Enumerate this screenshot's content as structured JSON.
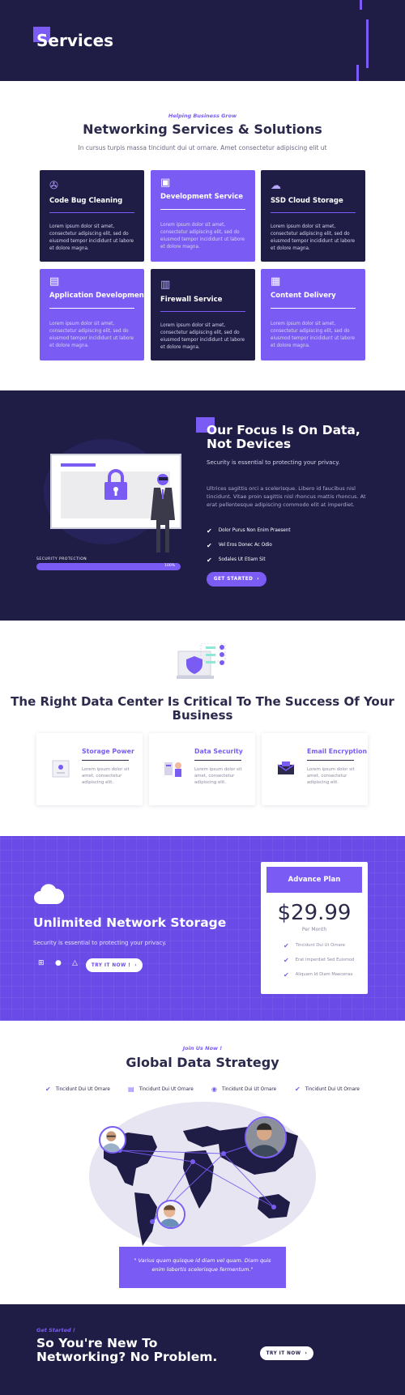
{
  "hero": {
    "title": "Services"
  },
  "services": {
    "eyebrow": "Helping Business Grow",
    "title": "Networking Services & Solutions",
    "subtitle": "In cursus turpis massa tincidunt dui ut ornare. Amet consectetur adipiscing elit ut",
    "cards": [
      {
        "title": "Code Bug Cleaning",
        "desc": "Lorem ipsum dolor sit amet, consectetur adipiscing elit, sed do eiusmod tempor incididunt ut labore et dolore magna.",
        "icon": "bug-icon"
      },
      {
        "title": "Development Service",
        "desc": "Lorem ipsum dolor sit amet, consectetur adipiscing elit, sed do eiusmod tempor incididunt ut labore et dolore magna.",
        "icon": "code-icon"
      },
      {
        "title": "SSD Cloud Storage",
        "desc": "Lorem ipsum dolor sit amet, consectetur adipiscing elit, sed do eiusmod tempor incididunt ut labore et dolore magna.",
        "icon": "cloud-icon"
      },
      {
        "title": "Application Development",
        "desc": "Lorem ipsum dolor sit amet, consectetur adipiscing elit, sed do eiusmod tempor incididunt ut labore et dolore magna.",
        "icon": "app-icon"
      },
      {
        "title": "Firewall Service",
        "desc": "Lorem ipsum dolor sit amet, consectetur adipiscing elit, sed do eiusmod tempor incididunt ut labore et dolore magna.",
        "icon": "firewall-icon"
      },
      {
        "title": "Content Delivery",
        "desc": "Lorem ipsum dolor sit amet, consectetur adipiscing elit, sed do eiusmod tempor incididunt ut labore et dolore magna.",
        "icon": "server-icon"
      }
    ]
  },
  "focus": {
    "title": "Our Focus Is On Data, Not Devices",
    "subtitle": "Security is essential to protecting your privacy.",
    "text": "Ultrices sagittis orci a scelerisque. Libero id faucibus nisl tincidunt. Vitae proin sagittis nisl rhoncus mattis rhoncus. At erat pellentesque adipiscing commodo elit at imperdiet.",
    "items": [
      "Dolor Purus Non Enim Praesent",
      "Vel Eros Donec Ac Odio",
      "Sodales Ut Etiam Sit"
    ],
    "button": "GET STARTED",
    "progress_label": "SECURITY PROTECTION",
    "progress_value": "100%",
    "progress_fraction": 1.0
  },
  "datacenter": {
    "title": "The Right Data Center Is Critical To The Success Of Your Business",
    "features": [
      {
        "title": "Storage Power",
        "desc": "Lorem ipsum dolor sit amet, consectetur adipiscing elit."
      },
      {
        "title": "Data Security",
        "desc": "Lorem ipsum dolor sit amet, consectetur adipiscing elit."
      },
      {
        "title": "Email Encryption",
        "desc": "Lorem ipsum dolor sit amet, consectetur adipiscing elit."
      }
    ]
  },
  "storage": {
    "title": "Unlimited Network Storage",
    "subtitle": "Security is essential to protecting your privacy.",
    "button": "TRY IT NOW !",
    "plan": {
      "name": "Advance Plan",
      "price": "$29.99",
      "period": "Per Month",
      "items": [
        "Tincidunt Dui Ut Ornare",
        "Erat Imperdiet Sed Euismod",
        "Aliquam Id Diam Maecenas"
      ]
    }
  },
  "global": {
    "eyebrow": "Join Us Now !",
    "title": "Global Data Strategy",
    "features": [
      "Tincidunt Dui Ut Ornare",
      "Tincidunt Dui Ut Ornare",
      "Tincidunt Dui Ut Ornare",
      "Tincidunt Dui Ut Ornare"
    ],
    "quote": "\" Varius quam quisque id diam vel quam. Diam quis enim lobortis scelerisque fermentum.\""
  },
  "cta": {
    "eyebrow": "Get Started !",
    "title": "So You're New To Networking? No Problem.",
    "button": "TRY IT NOW"
  },
  "colors": {
    "navy": "#1f1c46",
    "violet": "#7a5cf5"
  }
}
